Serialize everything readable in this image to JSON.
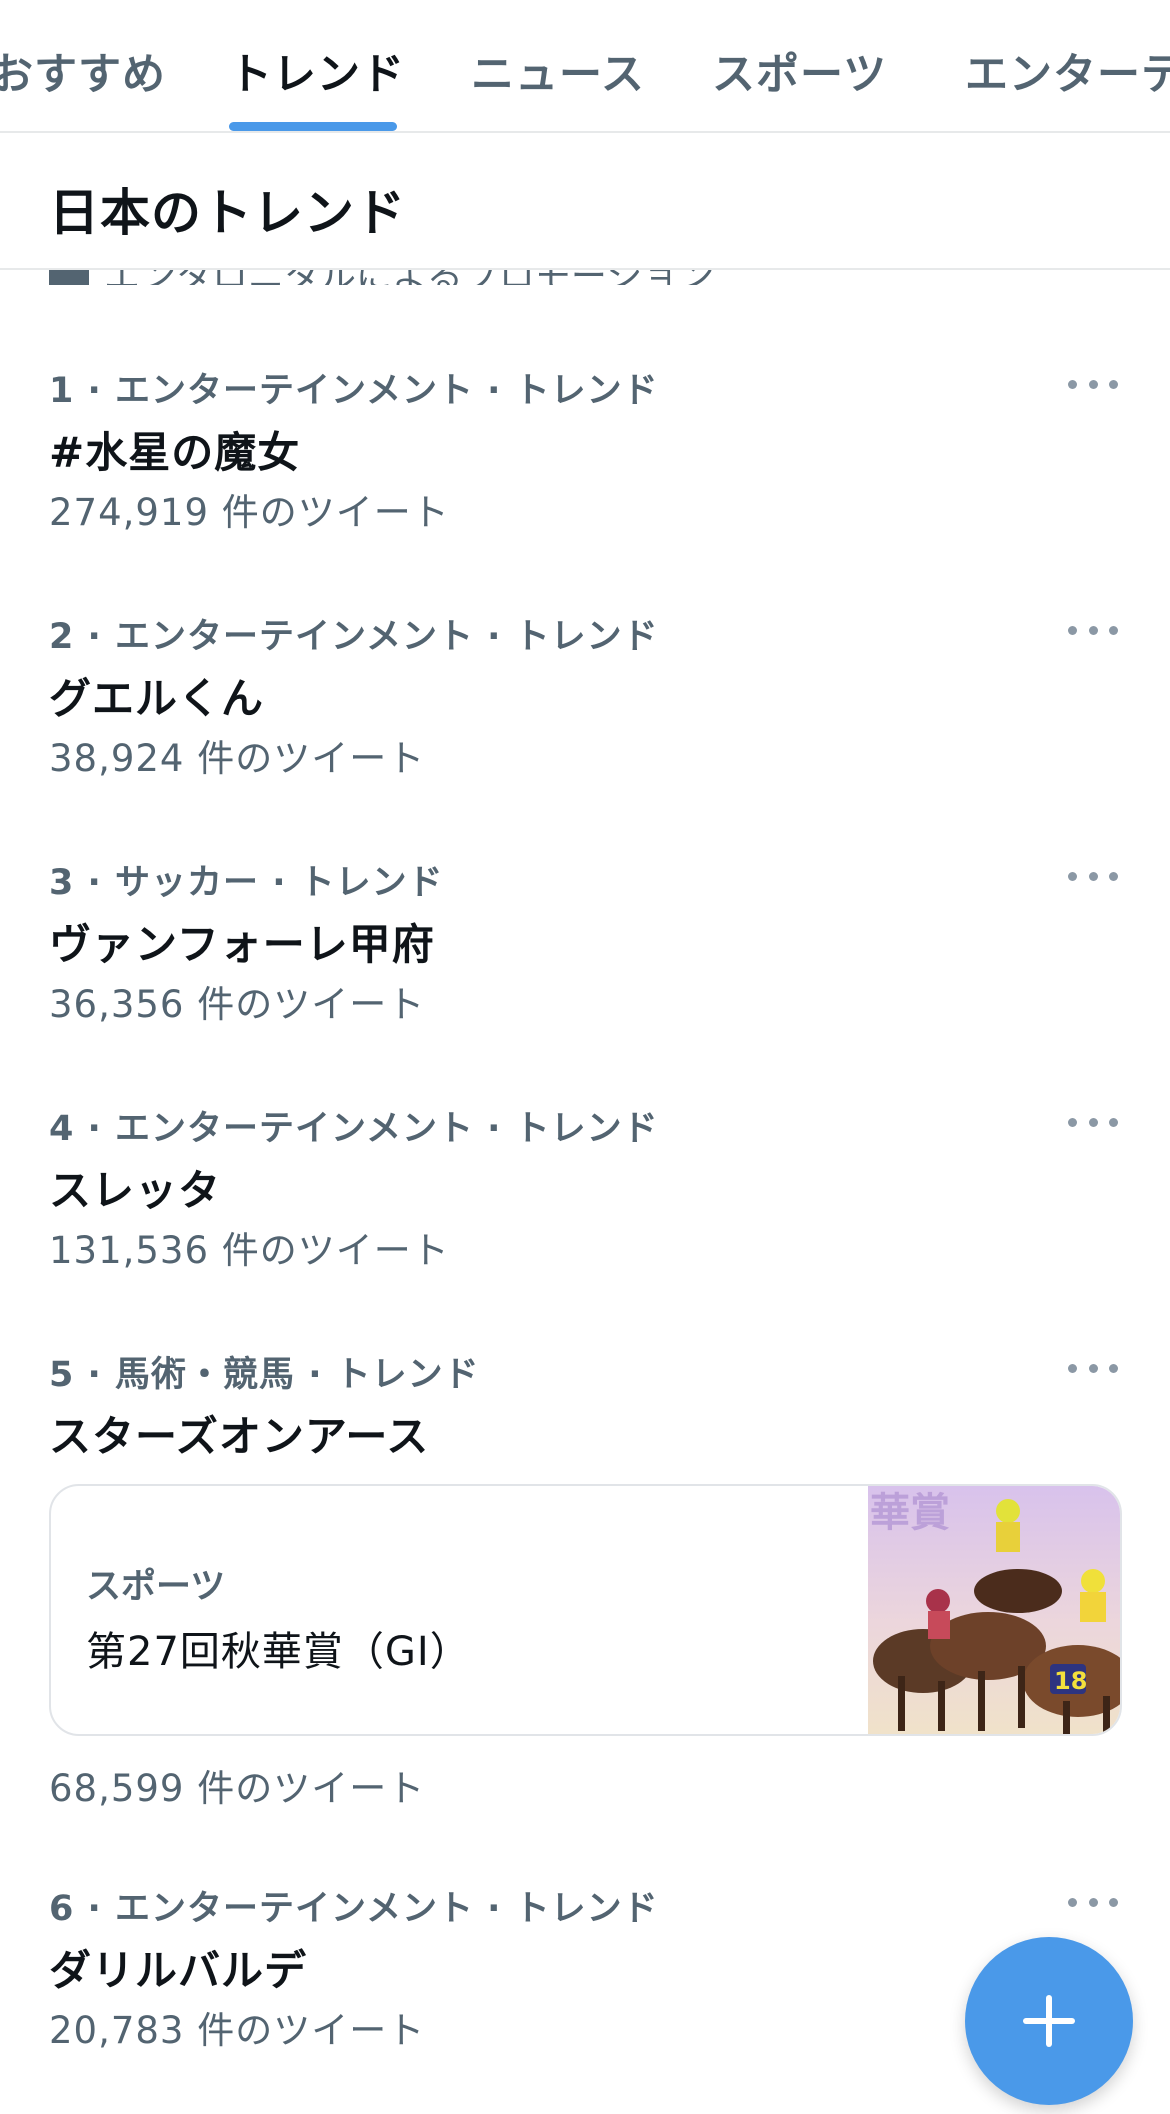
{
  "tabs": [
    {
      "label": "おすすめ",
      "active": false
    },
    {
      "label": "トレンド",
      "active": true
    },
    {
      "label": "ニュース",
      "active": false
    },
    {
      "label": "スポーツ",
      "active": false
    },
    {
      "label": "エンターテ",
      "active": false
    }
  ],
  "section": {
    "title": "日本のトレンド"
  },
  "promo": {
    "text": "エンタロニタルによるプロモーション"
  },
  "trends": [
    {
      "meta": "1 · エンターテインメント · トレンド",
      "name": "#水星の魔女",
      "count": "274,919 件のツイート"
    },
    {
      "meta": "2 · エンターテインメント · トレンド",
      "name": "グエルくん",
      "count": "38,924 件のツイート"
    },
    {
      "meta": "3 · サッカー · トレンド",
      "name": "ヴァンフォーレ甲府",
      "count": "36,356 件のツイート"
    },
    {
      "meta": "4 · エンターテインメント · トレンド",
      "name": "スレッタ",
      "count": "131,536 件のツイート"
    },
    {
      "meta": "5 · 馬術・競馬 · トレンド",
      "name": "スターズオンアース",
      "count": "68,599 件のツイート"
    },
    {
      "meta": "6 · エンターテインメント · トレンド",
      "name": "ダリルバルデ",
      "count": "20,783 件のツイート"
    }
  ],
  "card": {
    "category": "スポーツ",
    "title": "第27回秋華賞（GI）",
    "image_text": "華賞",
    "saddle_number": "18"
  },
  "icons": {
    "more": "more-horizontal-icon",
    "compose": "plus-icon"
  },
  "colors": {
    "accent": "#4a99e9",
    "secondary_text": "#536471",
    "primary_text": "#0f1419",
    "divider": "#e7e9ea"
  }
}
